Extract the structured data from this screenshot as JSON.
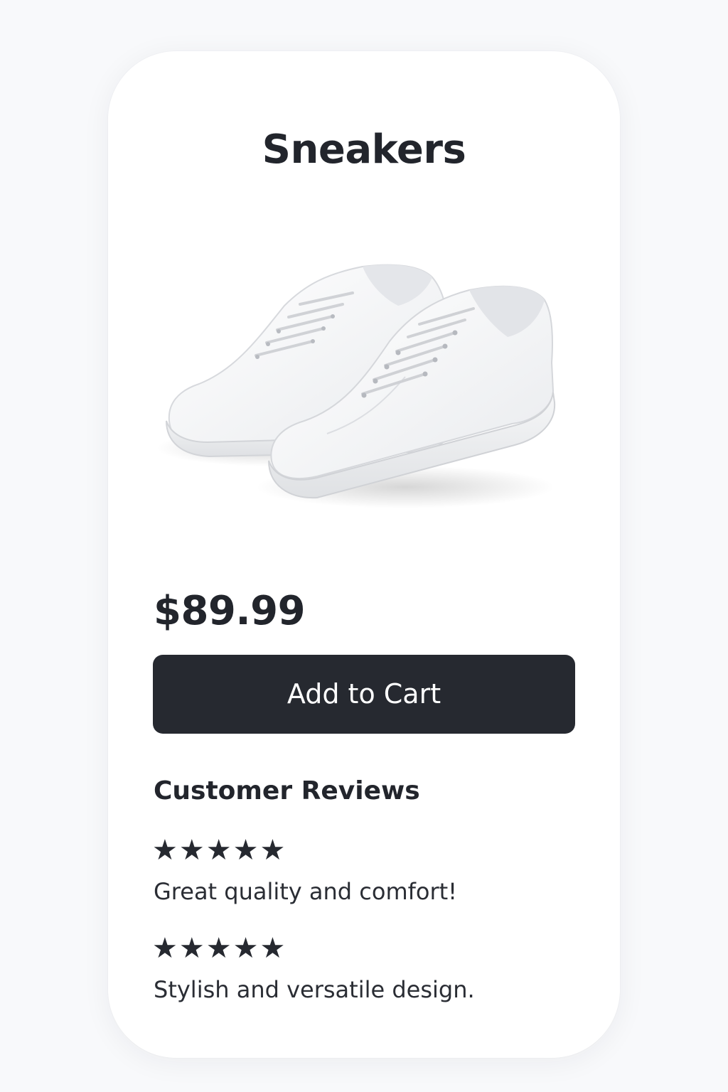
{
  "product": {
    "title": "Sneakers",
    "image_icon": "white-sneakers-image",
    "price": "$89.99"
  },
  "actions": {
    "add_to_cart_label": "Add to Cart",
    "button_color": "#262930"
  },
  "reviews": {
    "heading": "Customer Reviews",
    "items": [
      {
        "rating": 5,
        "stars": "★★★★★",
        "text": "Great quality and comfort!"
      },
      {
        "rating": 5,
        "stars": "★★★★★",
        "text": "Stylish and versatile design."
      }
    ]
  }
}
